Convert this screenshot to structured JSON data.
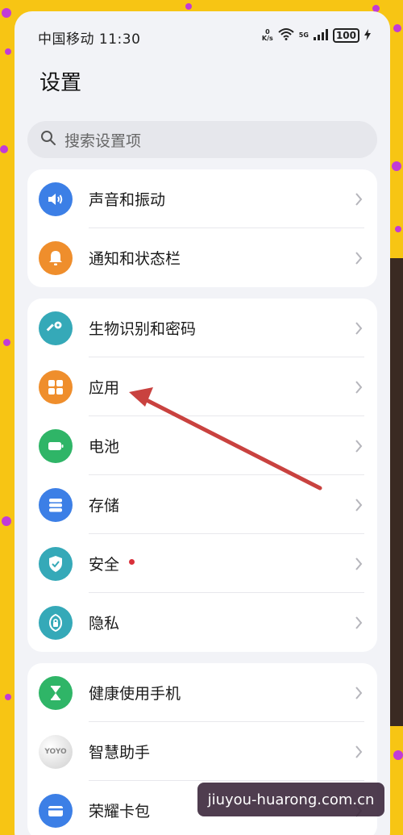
{
  "statusbar": {
    "carrier_time": "中国移动 11:30",
    "speed_value": "0",
    "speed_unit": "K/s",
    "network": "5G",
    "battery": "100"
  },
  "page": {
    "title": "设置"
  },
  "search": {
    "placeholder": "搜索设置项"
  },
  "groups": [
    {
      "items": [
        {
          "label": "声音和振动",
          "icon": "volume-icon",
          "color": "#3c7fe6"
        },
        {
          "label": "通知和状态栏",
          "icon": "bell-icon",
          "color": "#ef8e2c"
        }
      ]
    },
    {
      "items": [
        {
          "label": "生物识别和密码",
          "icon": "key-icon",
          "color": "#35a9b8"
        },
        {
          "label": "应用",
          "icon": "apps-grid-icon",
          "color": "#ef8e2c"
        },
        {
          "label": "电池",
          "icon": "battery-icon",
          "color": "#2fb567"
        },
        {
          "label": "存储",
          "icon": "storage-icon",
          "color": "#3c7fe6"
        },
        {
          "label": "安全",
          "icon": "shield-icon",
          "color": "#35a9b8"
        },
        {
          "label": "隐私",
          "icon": "privacy-lock-icon",
          "color": "#35a9b8"
        }
      ]
    },
    {
      "items": [
        {
          "label": "健康使用手机",
          "icon": "hourglass-icon",
          "color": "#2fb567"
        },
        {
          "label": "智慧助手",
          "icon": "yoyo-icon",
          "color": "#d8d8d8",
          "icon_text": "YOYO"
        },
        {
          "label": "荣耀卡包",
          "icon": "wallet-card-icon",
          "color": "#3c7fe6"
        }
      ]
    }
  ],
  "watermark": "jiuyou-huarong.com.cn",
  "colors": {
    "background": "#f7c514",
    "accent_dots": "#c23bd6",
    "annotation_arrow": "#c9423f",
    "security_badge": "#d9303a"
  }
}
